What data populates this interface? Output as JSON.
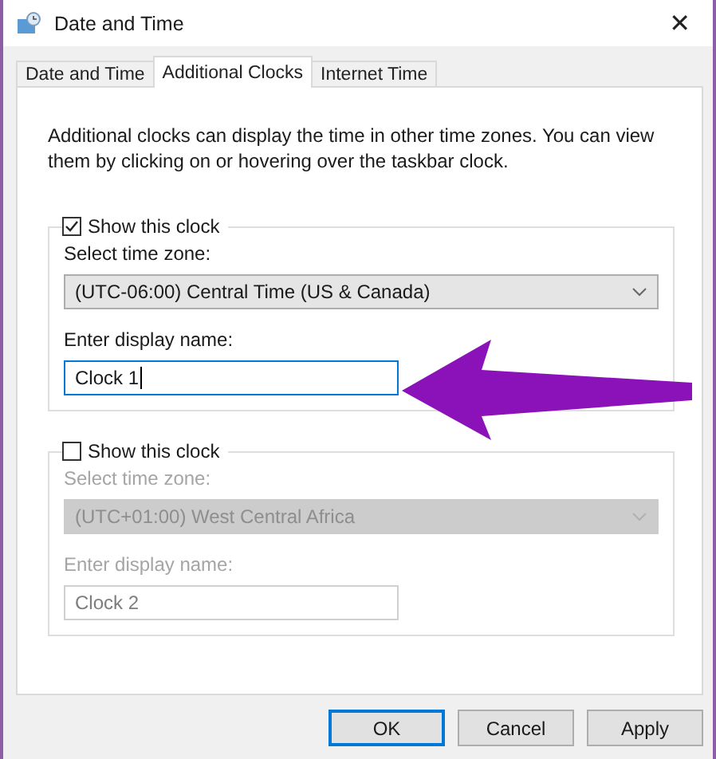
{
  "window": {
    "title": "Date and Time",
    "close": "✕"
  },
  "tabs": [
    {
      "label": "Date and Time",
      "selected": false
    },
    {
      "label": "Additional Clocks",
      "selected": true
    },
    {
      "label": "Internet Time",
      "selected": false
    }
  ],
  "description": "Additional clocks can display the time in other time zones. You can view them by clicking on or hovering over the taskbar clock.",
  "clocks": [
    {
      "show_label": "Show this clock",
      "checked": true,
      "timezone_label": "Select time zone:",
      "timezone": "(UTC-06:00) Central Time (US & Canada)",
      "name_label": "Enter display name:",
      "name": "Clock 1",
      "focused": true
    },
    {
      "show_label": "Show this clock",
      "checked": false,
      "timezone_label": "Select time zone:",
      "timezone": "(UTC+01:00) West Central Africa",
      "name_label": "Enter display name:",
      "name": "Clock 2",
      "focused": false
    }
  ],
  "buttons": [
    {
      "label": "OK",
      "default": true
    },
    {
      "label": "Cancel",
      "default": false
    },
    {
      "label": "Apply",
      "default": false
    }
  ]
}
